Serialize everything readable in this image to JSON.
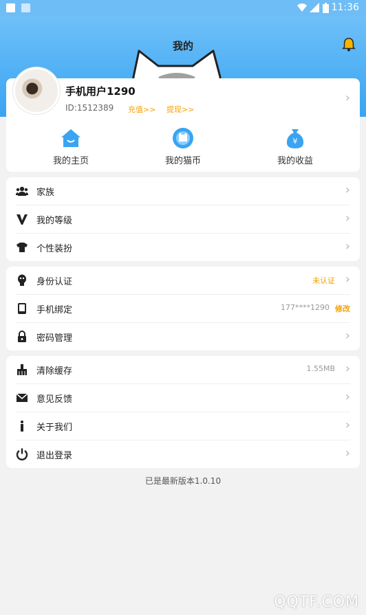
{
  "status_bar": {
    "time": "11:36"
  },
  "header": {
    "title": "我的"
  },
  "profile": {
    "username": "手机用户1290",
    "id_text": "ID:1512389",
    "recharge_label": "充值>>",
    "withdraw_label": "提现>>"
  },
  "quick_actions": [
    {
      "label": "我的主页",
      "icon": "home-icon"
    },
    {
      "label": "我的猫币",
      "icon": "cat-coin-icon"
    },
    {
      "label": "我的收益",
      "icon": "money-bag-icon"
    }
  ],
  "group1": [
    {
      "label": "家族",
      "icon": "group-icon"
    },
    {
      "label": "我的等级",
      "icon": "level-v-icon"
    },
    {
      "label": "个性装扮",
      "icon": "tshirt-icon"
    }
  ],
  "group2": [
    {
      "label": "身份认证",
      "icon": "identity-icon",
      "right": "未认证"
    },
    {
      "label": "手机绑定",
      "icon": "phone-icon",
      "right": "177****1290",
      "action": "修改"
    },
    {
      "label": "密码管理",
      "icon": "lock-icon"
    }
  ],
  "group3": [
    {
      "label": "清除缓存",
      "icon": "broom-icon",
      "right": "1.55MB"
    },
    {
      "label": "意见反馈",
      "icon": "mail-icon"
    },
    {
      "label": "关于我们",
      "icon": "info-icon"
    },
    {
      "label": "退出登录",
      "icon": "power-icon"
    }
  ],
  "footer": {
    "version": "已是最新版本1.0.10",
    "watermark": "QQTF.COM"
  },
  "colors": {
    "accent": "#3aa4f2",
    "orange": "#f5a100",
    "chevron": "#b5b5b5"
  }
}
